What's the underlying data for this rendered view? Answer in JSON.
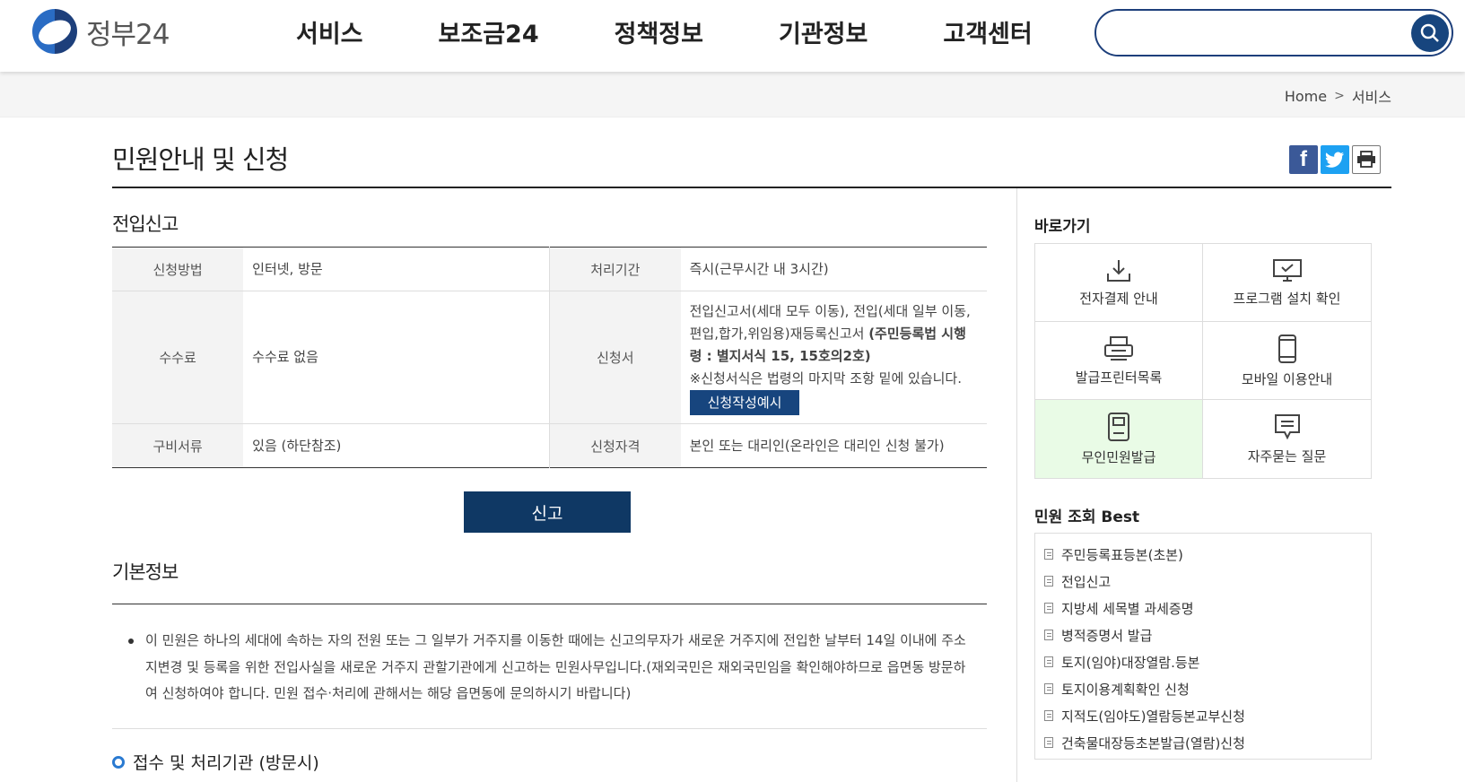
{
  "header": {
    "logo_text": "정부24",
    "nav": [
      "서비스",
      "보조금24",
      "정책정보",
      "기관정보",
      "고객센터"
    ],
    "search": {
      "placeholder": "",
      "value": ""
    }
  },
  "breadcrumb": {
    "home": "Home",
    "current": "서비스"
  },
  "page_title": "민원안내 및 신청",
  "service": {
    "title": "전입신고",
    "rows": [
      {
        "h1": "신청방법",
        "v1": "인터넷, 방문",
        "h2": "처리기간",
        "v2": "즉시(근무시간 내 3시간)"
      },
      {
        "h1": "수수료",
        "v1": "수수료 없음",
        "h2": "신청서",
        "v2_text": "전입신고서(세대 모두 이동), 전입(세대 일부 이동, 편입,합가,위임용)재등록신고서 ",
        "v2_bold": "(주민등록법 시행령 : 별지서식 15, 15호의2호)",
        "v2_note": "※신청서식은 법령의 마지막 조항 밑에 있습니다.",
        "example_button": "신청작성예시"
      },
      {
        "h1": "구비서류",
        "v1": "있음 (하단참조)",
        "h2": "신청자격",
        "v2": "본인 또는 대리인(온라인은 대리인 신청 불가)"
      }
    ],
    "report_button": "신고"
  },
  "basic_info": {
    "title": "기본정보",
    "text": "이 민원은 하나의 세대에 속하는 자의 전원 또는 그 일부가 거주지를 이동한 때에는 신고의무자가 새로운 거주지에 전입한 날부터 14일 이내에 주소지변경 및 등록을 위한 전입사실을 새로운 거주지 관할기관에게 신고하는 민원사무입니다.(재외국민은 재외국민임을 확인해야하므로 읍면동 방문하여 신청하여야 합니다. 민원 접수·처리에 관해서는 해당 읍면동에 문의하시기 바랍니다)"
  },
  "sub_section": "접수 및 처리기관 (방문시)",
  "sidebar": {
    "quick_title": "바로가기",
    "quick": [
      {
        "label": "전자결제 안내",
        "icon": "download-icon"
      },
      {
        "label": "프로그램 설치 확인",
        "icon": "monitor-icon"
      },
      {
        "label": "발급프린터목록",
        "icon": "printer-icon"
      },
      {
        "label": "모바일 이용안내",
        "icon": "mobile-icon"
      },
      {
        "label": "무인민원발급",
        "icon": "kiosk-icon"
      },
      {
        "label": "자주묻는 질문",
        "icon": "chat-icon"
      }
    ],
    "best_title": "민원 조회 Best",
    "best": [
      "주민등록표등본(초본)",
      "전입신고",
      "지방세 세목별 과세증명",
      "병적증명서 발급",
      "토지(임야)대장열람.등본",
      "토지이용계획확인 신청",
      "지적도(임야도)열람등본교부신청",
      "건축물대장등초본발급(열람)신청"
    ]
  },
  "colors": {
    "primary": "#17457e",
    "button_dark": "#0f3864",
    "highlight": "#e9fbe6"
  }
}
